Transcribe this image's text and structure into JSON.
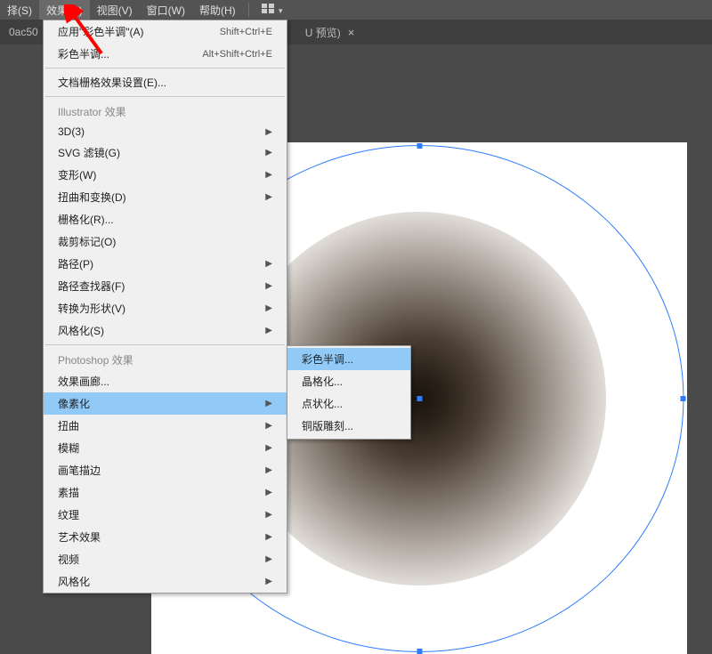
{
  "menubar": {
    "items": [
      {
        "label": "择(S)"
      },
      {
        "label": "效果(C)"
      },
      {
        "label": "视图(V)"
      },
      {
        "label": "窗口(W)"
      },
      {
        "label": "帮助(H)"
      }
    ]
  },
  "tabbar": {
    "left": "0ac50",
    "right": "U 预览)",
    "close": "×"
  },
  "dropdown": {
    "apply_last": {
      "label": "应用\"彩色半调\"(A)",
      "shortcut": "Shift+Ctrl+E"
    },
    "color_halftone": {
      "label": "彩色半调...",
      "shortcut": "Alt+Shift+Ctrl+E"
    },
    "doc_raster": {
      "label": "文档栅格效果设置(E)..."
    },
    "illustrator_header": "Illustrator 效果",
    "three_d": {
      "label": "3D(3)"
    },
    "svg_filter": {
      "label": "SVG 滤镜(G)"
    },
    "transform": {
      "label": "变形(W)"
    },
    "distort": {
      "label": "扭曲和变换(D)"
    },
    "rasterize": {
      "label": "栅格化(R)..."
    },
    "crop_marks": {
      "label": "裁剪标记(O)"
    },
    "path": {
      "label": "路径(P)"
    },
    "pathfinder": {
      "label": "路径查找器(F)"
    },
    "convert_shape": {
      "label": "转换为形状(V)"
    },
    "stylize_ai": {
      "label": "风格化(S)"
    },
    "photoshop_header": "Photoshop 效果",
    "effect_gallery": {
      "label": "效果画廊..."
    },
    "pixelate": {
      "label": "像素化"
    },
    "distort_ps": {
      "label": "扭曲"
    },
    "blur": {
      "label": "模糊"
    },
    "brush_strokes": {
      "label": "画笔描边"
    },
    "sketch": {
      "label": "素描"
    },
    "texture": {
      "label": "纹理"
    },
    "artistic": {
      "label": "艺术效果"
    },
    "video": {
      "label": "视频"
    },
    "stylize_ps": {
      "label": "风格化"
    }
  },
  "submenu": {
    "color_halftone": "彩色半调...",
    "crystallize": "晶格化...",
    "pointillize": "点状化...",
    "mezzotint": "铜版雕刻..."
  }
}
